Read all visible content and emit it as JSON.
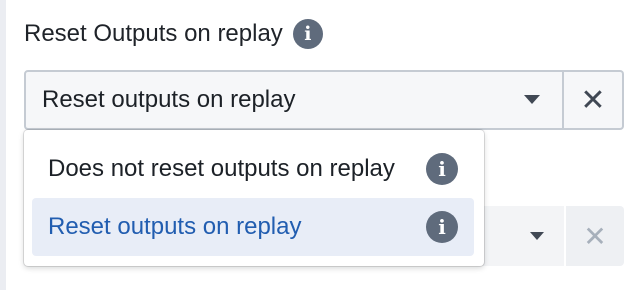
{
  "field": {
    "label": "Reset Outputs on replay",
    "selected_value": "Reset outputs on replay",
    "clear_symbol": "✕"
  },
  "dropdown": {
    "options": [
      {
        "label": "Does not reset outputs on replay",
        "selected": false
      },
      {
        "label": "Reset outputs on replay",
        "selected": true
      }
    ]
  },
  "second_field": {
    "clear_symbol": "✕"
  },
  "icons": {
    "info_glyph": "i"
  },
  "colors": {
    "accent_text": "#215db0",
    "selected_bg": "#e8edf7",
    "icon_gray": "#5f6b7c"
  }
}
